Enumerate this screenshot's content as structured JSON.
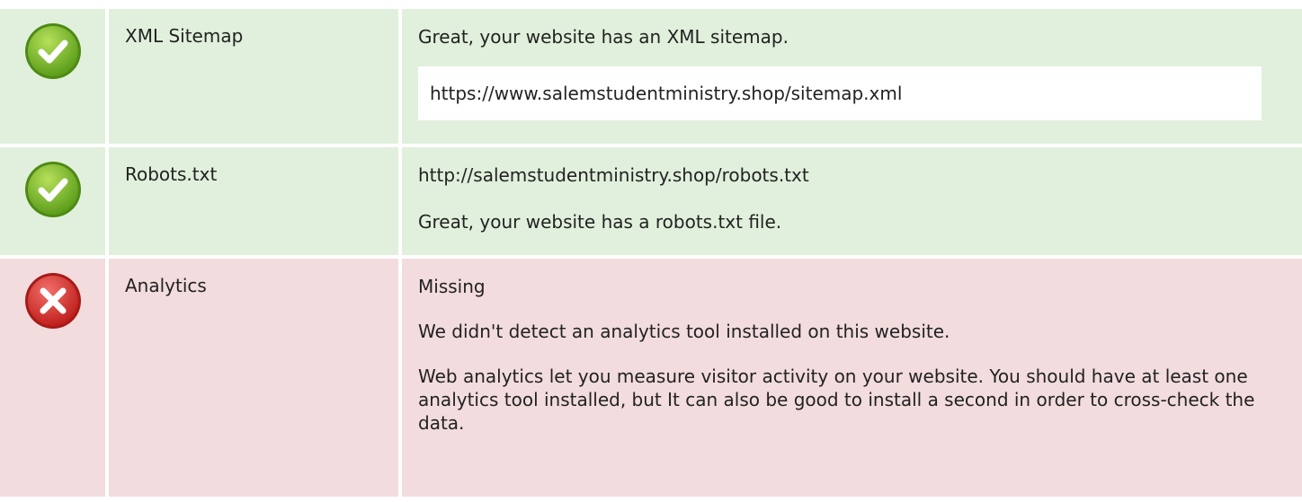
{
  "rows": [
    {
      "name": "XML Sitemap",
      "status": "pass",
      "icon": "check-icon",
      "message": "Great, your website has an XML sitemap.",
      "url": "https://www.salemstudentministry.shop/sitemap.xml"
    },
    {
      "name": "Robots.txt",
      "status": "pass",
      "icon": "check-icon",
      "url": "http://salemstudentministry.shop/robots.txt",
      "message": "Great, your website has a robots.txt file."
    },
    {
      "name": "Analytics",
      "status": "fail",
      "icon": "cross-icon",
      "value": "Missing",
      "message": "We didn't detect an analytics tool installed on this website.",
      "detail": "Web analytics let you measure visitor activity on your website. You should have at least one analytics tool installed, but It can also be good to install a second in order to cross-check the data."
    }
  ],
  "colors": {
    "pass_bg": "#e1f0dc",
    "fail_bg": "#f2dcde",
    "pass_icon": "#7dbb2e",
    "fail_icon": "#d9302d"
  }
}
